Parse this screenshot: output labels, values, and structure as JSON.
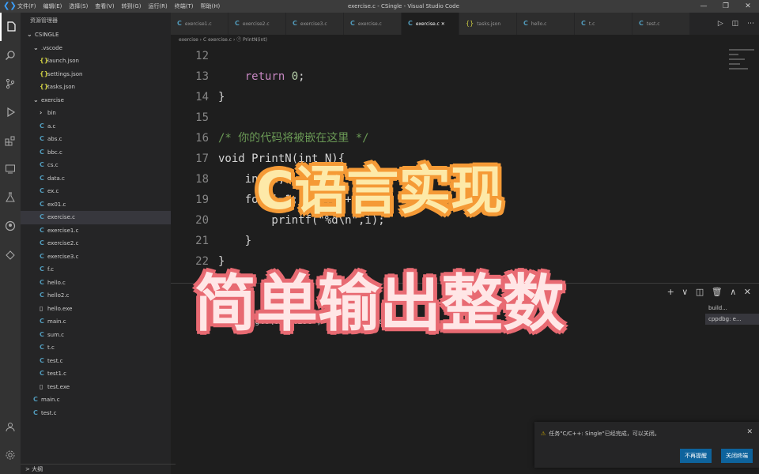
{
  "titlebar": {
    "menu": [
      "文件(F)",
      "编辑(E)",
      "选择(S)",
      "查看(V)",
      "转到(G)",
      "运行(R)",
      "终端(T)",
      "帮助(H)"
    ],
    "title": "exercise.c - CSingle - Visual Studio Code",
    "controls": [
      "—",
      "❐",
      "✕"
    ]
  },
  "sidebar": {
    "title": "资源管理器",
    "root": "CSINGLE",
    "items": [
      {
        "label": ".vscode",
        "icon": "chevron-down",
        "indent": 1
      },
      {
        "label": "launch.json",
        "icon": "json",
        "indent": 2
      },
      {
        "label": "settings.json",
        "icon": "json",
        "indent": 2
      },
      {
        "label": "tasks.json",
        "icon": "json",
        "indent": 2
      },
      {
        "label": "exercise",
        "icon": "chevron-down",
        "indent": 1
      },
      {
        "label": "bin",
        "icon": "chevron-right",
        "indent": 2
      },
      {
        "label": "a.c",
        "icon": "c",
        "indent": 2
      },
      {
        "label": "abs.c",
        "icon": "c",
        "indent": 2
      },
      {
        "label": "bbc.c",
        "icon": "c",
        "indent": 2
      },
      {
        "label": "cs.c",
        "icon": "c",
        "indent": 2
      },
      {
        "label": "data.c",
        "icon": "c",
        "indent": 2
      },
      {
        "label": "ex.c",
        "icon": "c",
        "indent": 2
      },
      {
        "label": "ex01.c",
        "icon": "c",
        "indent": 2
      },
      {
        "label": "exercise.c",
        "icon": "c",
        "indent": 2,
        "selected": true
      },
      {
        "label": "exercise1.c",
        "icon": "c",
        "indent": 2
      },
      {
        "label": "exercise2.c",
        "icon": "c",
        "indent": 2
      },
      {
        "label": "exercise3.c",
        "icon": "c",
        "indent": 2
      },
      {
        "label": "f.c",
        "icon": "c",
        "indent": 2
      },
      {
        "label": "hello.c",
        "icon": "c",
        "indent": 2
      },
      {
        "label": "hello2.c",
        "icon": "c",
        "indent": 2
      },
      {
        "label": "hello.exe",
        "icon": "file",
        "indent": 2
      },
      {
        "label": "main.c",
        "icon": "c",
        "indent": 2
      },
      {
        "label": "sum.c",
        "icon": "c",
        "indent": 2
      },
      {
        "label": "t.c",
        "icon": "c",
        "indent": 2
      },
      {
        "label": "test.c",
        "icon": "c",
        "indent": 2
      },
      {
        "label": "test1.c",
        "icon": "c",
        "indent": 2
      },
      {
        "label": "test.exe",
        "icon": "file",
        "indent": 2
      },
      {
        "label": "main.c",
        "icon": "c",
        "indent": 1
      },
      {
        "label": "test.c",
        "icon": "c",
        "indent": 1
      }
    ],
    "footer": "> 大纲"
  },
  "tabs": [
    {
      "label": "exercise1.c",
      "type": "c",
      "active": false
    },
    {
      "label": "exercise2.c",
      "type": "c",
      "active": false
    },
    {
      "label": "exercise3.c",
      "type": "c",
      "active": false
    },
    {
      "label": "exercise.c",
      "type": "c",
      "active": false
    },
    {
      "label": "exercise.c",
      "type": "c",
      "active": true
    },
    {
      "label": "tasks.json",
      "type": "json",
      "active": false
    },
    {
      "label": "hello.c",
      "type": "c",
      "active": false
    },
    {
      "label": "t.c",
      "type": "c",
      "active": false
    },
    {
      "label": "test.c",
      "type": "c",
      "active": false
    }
  ],
  "tab_actions": [
    "▷",
    "◫",
    "⋯"
  ],
  "breadcrumb": "exercise › C exercise.c › ⓕ PrintN(int)",
  "editor": {
    "lines": [
      {
        "n": "12",
        "code": ""
      },
      {
        "n": "13",
        "code": "    return 0;"
      },
      {
        "n": "14",
        "code": "}"
      },
      {
        "n": "15",
        "code": ""
      },
      {
        "n": "16",
        "code": "/* 你的代码将被嵌在这里 */"
      },
      {
        "n": "17",
        "code": "void PrintN(int N){"
      },
      {
        "n": "18",
        "code": "    int i;"
      },
      {
        "n": "19",
        "code": "    for(i=1;i<=N;i++){"
      },
      {
        "n": "20",
        "code": "        printf(\"%d\\n\",i);"
      },
      {
        "n": "21",
        "code": "    }"
      },
      {
        "n": "22",
        "code": "}"
      }
    ]
  },
  "panel": {
    "line1": "PS",
    "line2": "cd ...\\CSingle\\exercise ; ./exercise.exe",
    "actions": [
      "+",
      "∨",
      "◫",
      "🗑",
      "∧",
      "✕"
    ],
    "terminals": [
      {
        "label": "build...",
        "active": false
      },
      {
        "label": "cppdbg: e...",
        "active": true
      }
    ]
  },
  "toast": {
    "message": "任务\"C/C++: Single\"已经完成，可以关闭。",
    "buttons": [
      "不再提醒",
      "关闭终端"
    ],
    "close": "✕"
  },
  "overlay": {
    "line1": "C语言实现",
    "line2": "简单输出整数"
  }
}
